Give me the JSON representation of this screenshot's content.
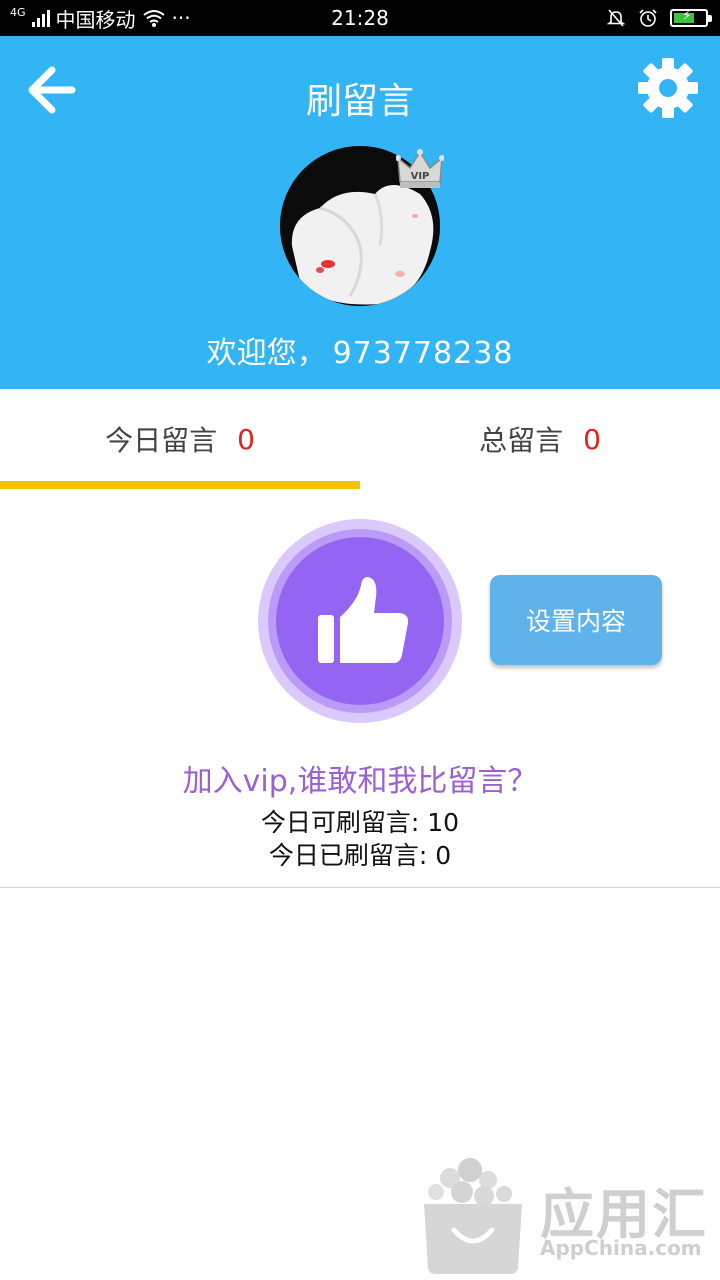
{
  "status_bar": {
    "network": "4G",
    "carrier": "中国移动",
    "more": "···",
    "time": "21:28"
  },
  "header": {
    "title": "刷留言",
    "welcome_label": "欢迎您，",
    "user_id": "973778238",
    "vip_badge": "VIP"
  },
  "tabs": [
    {
      "label": "今日留言",
      "count": "0"
    },
    {
      "label": "总留言",
      "count": "0"
    }
  ],
  "main": {
    "set_content_label": "设置内容",
    "promo_text": "加入vip,谁敢和我比留言？",
    "today_available_label": "今日可刷留言:",
    "today_available_value": "10",
    "today_done_label": "今日已刷留言:",
    "today_done_value": "0"
  },
  "watermark": {
    "logo_text": "应用汇",
    "logo_sub": "AppChina.com"
  },
  "colors": {
    "header_bg": "#33b5f5",
    "tab_indicator": "#f5c400",
    "count_red": "#e52222",
    "like_purple": "#9365f2",
    "promo_purple": "#9b5fd6",
    "button_blue": "#5fb3ea"
  },
  "icons": {
    "back": "arrow-left-icon",
    "settings": "gear-icon",
    "like": "thumbs-up-icon",
    "vip": "crown-icon"
  }
}
